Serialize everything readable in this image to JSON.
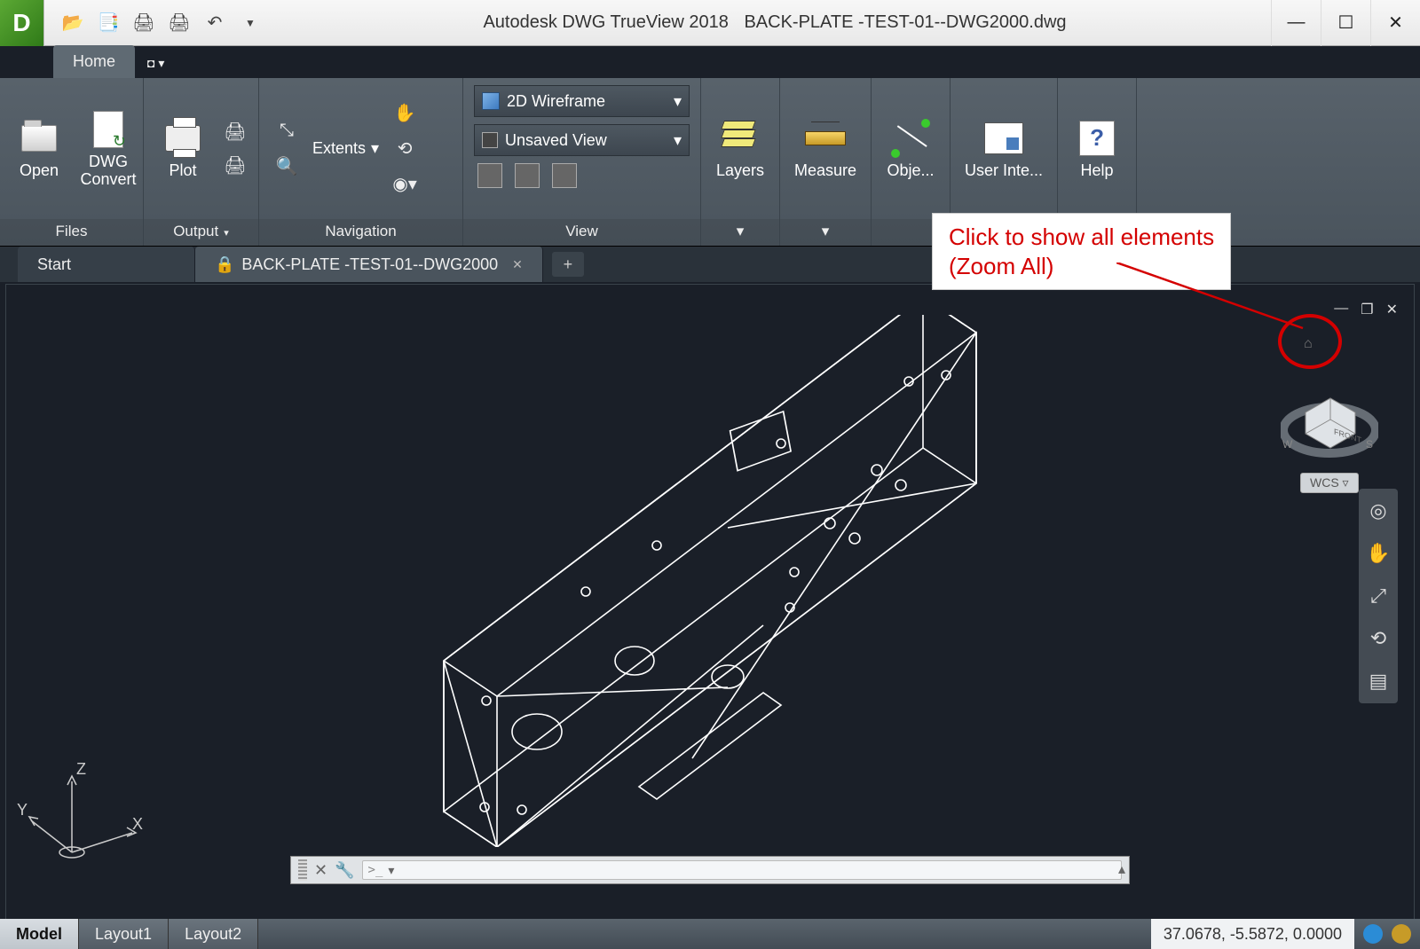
{
  "title": {
    "app": "Autodesk DWG TrueView 2018",
    "file": "BACK-PLATE -TEST-01--DWG2000.dwg"
  },
  "ribbon": {
    "home_tab": "Home",
    "panels": {
      "files": {
        "label": "Files",
        "open": "Open",
        "convert": "DWG\nConvert"
      },
      "output": {
        "label": "Output",
        "plot": "Plot"
      },
      "navigation": {
        "label": "Navigation",
        "extents": "Extents"
      },
      "view": {
        "label": "View",
        "style": "2D Wireframe",
        "saved_view": "Unsaved View"
      },
      "layers": {
        "label": "Layers"
      },
      "measure": {
        "label": "Measure"
      },
      "object": {
        "label": "Obje..."
      },
      "ui": {
        "label": "User Inte..."
      },
      "help": {
        "label": "Help"
      }
    }
  },
  "doctabs": {
    "start": "Start",
    "active": "BACK-PLATE -TEST-01--DWG2000"
  },
  "annotation": {
    "line1": "Click to show all elements",
    "line2": "(Zoom All)"
  },
  "viewcube": {
    "wcs": "WCS",
    "front": "FRONT"
  },
  "ucs": {
    "x": "X",
    "y": "Y",
    "z": "Z"
  },
  "bottom": {
    "model": "Model",
    "layout1": "Layout1",
    "layout2": "Layout2",
    "coords": "37.0678, -5.5872, 0.0000"
  }
}
